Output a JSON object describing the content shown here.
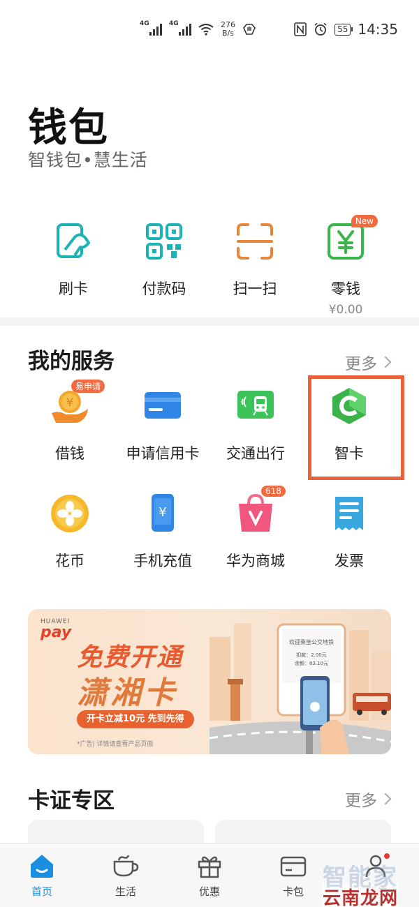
{
  "status_bar": {
    "network_1": "4G",
    "network_2": "4G",
    "speed_value": "276",
    "speed_unit": "B/s",
    "battery": "55",
    "time": "14:35"
  },
  "header": {
    "title": "钱包",
    "subtitle": "智钱包•慧生活"
  },
  "quick_actions": [
    {
      "label": "刷卡",
      "icon": "card-tap-icon"
    },
    {
      "label": "付款码",
      "icon": "qr-code-icon"
    },
    {
      "label": "扫一扫",
      "icon": "scan-icon"
    },
    {
      "label": "零钱",
      "icon": "yuan-wallet-icon",
      "badge": "New",
      "value": "¥0.00"
    }
  ],
  "services": {
    "title": "我的服务",
    "more": "更多",
    "items": [
      {
        "label": "借钱",
        "icon": "coin-hand-icon",
        "badge": "易申请"
      },
      {
        "label": "申请信用卡",
        "icon": "credit-card-icon"
      },
      {
        "label": "交通出行",
        "icon": "transit-card-icon"
      },
      {
        "label": "智卡",
        "icon": "smart-card-icon"
      },
      {
        "label": "花币",
        "icon": "flower-coin-icon"
      },
      {
        "label": "手机充值",
        "icon": "phone-topup-icon"
      },
      {
        "label": "华为商城",
        "icon": "shopping-bag-icon",
        "badge": "618"
      },
      {
        "label": "发票",
        "icon": "invoice-icon"
      }
    ]
  },
  "banner": {
    "brand_small": "HUAWEI",
    "brand_pay": "pay",
    "headline_1": "免费开通",
    "headline_2": "潇湘卡",
    "pill": "开卡立减10元 先到先得",
    "footnote": "*广告| 详情请查看产品页面",
    "sign_title": "欢迎乘坐公交地铁",
    "sign_line1": "扣款：2.00元",
    "sign_line2": "余额：83.10元"
  },
  "cards_zone": {
    "title": "卡证专区",
    "more": "更多"
  },
  "bottom_nav": [
    {
      "label": "首页",
      "icon": "home-icon",
      "active": true
    },
    {
      "label": "生活",
      "icon": "cup-icon"
    },
    {
      "label": "优惠",
      "icon": "gift-icon"
    },
    {
      "label": "卡包",
      "icon": "card-wallet-icon"
    },
    {
      "label": "我的",
      "icon": "person-icon"
    }
  ],
  "watermark": {
    "line1": "智能家",
    "line2": "云南龙网"
  },
  "colors": {
    "teal": "#1bb3b5",
    "orange": "#e8623c",
    "green": "#39b54a",
    "blue": "#2f86e6",
    "accent_blue": "#1a8fe0"
  }
}
